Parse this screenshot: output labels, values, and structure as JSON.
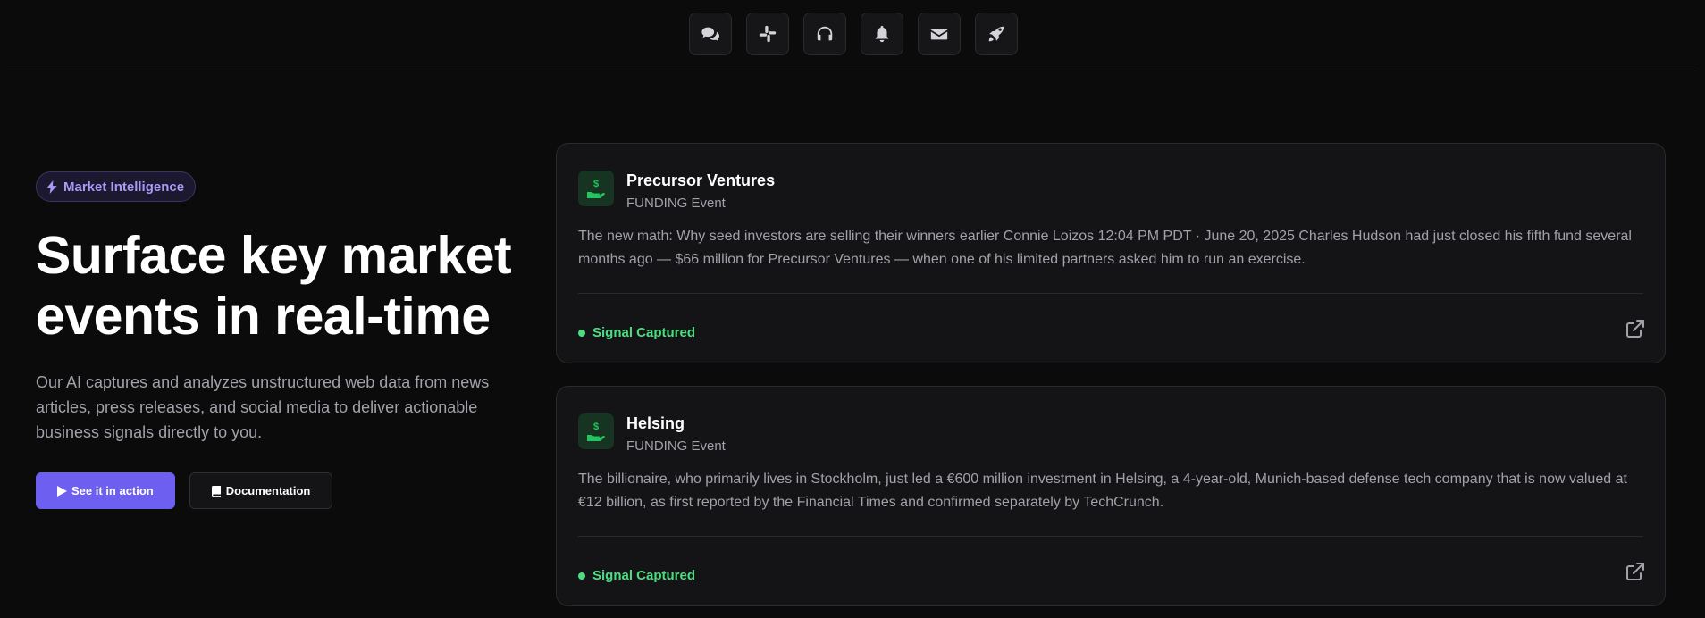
{
  "nav": {
    "icons": [
      "chat-icon",
      "slack-icon",
      "headphones-icon",
      "bell-icon",
      "envelope-icon",
      "rocket-icon"
    ]
  },
  "hero": {
    "badge": "Market Intelligence",
    "title": "Surface key market events in real-time",
    "description": "Our AI captures and analyzes unstructured web data from news articles, press releases, and social media to deliver actionable business signals directly to you.",
    "primary_button": "See it in action",
    "secondary_button": "Documentation"
  },
  "events": [
    {
      "company": "Precursor Ventures",
      "type": "FUNDING Event",
      "text": "The new math: Why seed investors are selling their winners earlier Connie Loizos 12:04 PM PDT · June 20, 2025 Charles Hudson had just closed his fifth fund several months ago — $66 million for Precursor Ventures — when one of his limited partners asked him to run an exercise.",
      "status": "Signal Captured"
    },
    {
      "company": "Helsing",
      "type": "FUNDING Event",
      "text": "The billionaire, who primarily lives in Stockholm, just led a €600 million investment in Helsing, a 4-year-old, Munich-based defense tech company that is now valued at €12 billion, as first reported by the Financial Times and confirmed separately by TechCrunch.",
      "status": "Signal Captured"
    }
  ],
  "colors": {
    "accent": "#6d5ff0",
    "signal": "#4ade80",
    "badge_text": "#a79bf5",
    "background": "#0b0b0c"
  }
}
